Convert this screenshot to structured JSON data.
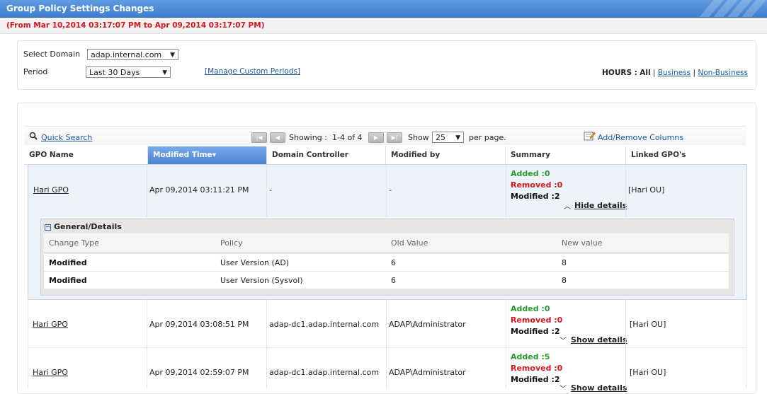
{
  "header": {
    "title": "Group Policy Settings Changes",
    "range": "(From Mar 10,2014 03:17:07 PM to Apr 09,2014 03:17:07 PM)"
  },
  "filters": {
    "domain_label": "Select Domain",
    "domain_value": "adap.internal.com",
    "period_label": "Period",
    "period_value": "Last 30 Days",
    "custom_periods_link": "[Manage Custom Periods]",
    "hours_label": "HOURS :",
    "hours_all": "All",
    "hours_sep": "|",
    "hours_business": "Business",
    "hours_non_business": "Non-Business"
  },
  "toolbar": {
    "quick_search": "Quick Search",
    "showing_label": "Showing :",
    "showing_range": "1-4 of 4",
    "show_label": "Show",
    "page_size": "25",
    "per_page": "per page.",
    "add_remove_columns": "Add/Remove Columns"
  },
  "columns": [
    "GPO Name",
    "Modified Time",
    "Domain Controller",
    "Modified by",
    "Summary",
    "Linked GPO's"
  ],
  "sort_indicator": "▾",
  "rows": [
    {
      "gpo": "Hari GPO",
      "time": "Apr 09,2014 03:11:21 PM",
      "dc": "-",
      "by": "-",
      "added": "Added :0",
      "removed": "Removed :0",
      "modified": "Modified :2",
      "toggle": "Hide details",
      "linked": "[Hari OU]"
    },
    {
      "gpo": "Hari GPO",
      "time": "Apr 09,2014 03:08:51 PM",
      "dc": "adap-dc1.adap.internal.com",
      "by": "ADAP\\Administrator",
      "added": "Added :0",
      "removed": "Removed :0",
      "modified": "Modified :2",
      "toggle": "Show details",
      "linked": "[Hari OU]"
    },
    {
      "gpo": "Hari GPO",
      "time": "Apr 09,2014 02:59:07 PM",
      "dc": "adap-dc1.adap.internal.com",
      "by": "ADAP\\Administrator",
      "added": "Added :5",
      "removed": "Removed :0",
      "modified": "Modified :2",
      "toggle": "Show details",
      "linked": "[Hari OU]"
    }
  ],
  "details": {
    "heading": "General/Details",
    "columns": [
      "Change Type",
      "Policy",
      "Old Value",
      "New value"
    ],
    "rows": [
      {
        "type": "Modified",
        "policy": "User Version (AD)",
        "old": "6",
        "new": "8"
      },
      {
        "type": "Modified",
        "policy": "User Version (Sysvol)",
        "old": "6",
        "new": "8"
      }
    ]
  },
  "colors": {
    "title_bar": "#4a88d8",
    "range_text": "#d6171f",
    "added": "#2a9a2a",
    "removed": "#d6171f",
    "link": "#1c5a9a",
    "sorted_column": "#5b92dc"
  }
}
